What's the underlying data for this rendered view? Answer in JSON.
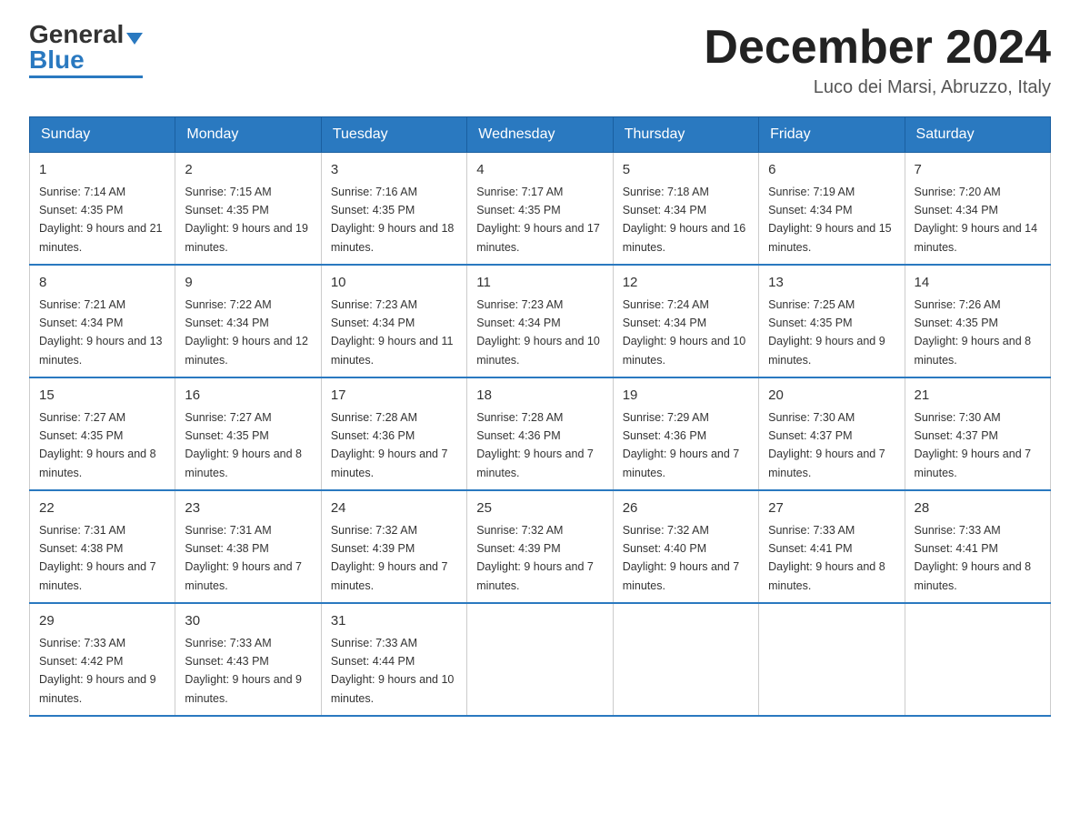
{
  "header": {
    "logo_general": "General",
    "logo_blue": "Blue",
    "month_title": "December 2024",
    "location": "Luco dei Marsi, Abruzzo, Italy"
  },
  "weekdays": [
    "Sunday",
    "Monday",
    "Tuesday",
    "Wednesday",
    "Thursday",
    "Friday",
    "Saturday"
  ],
  "weeks": [
    [
      {
        "day": "1",
        "sunrise": "7:14 AM",
        "sunset": "4:35 PM",
        "daylight": "9 hours and 21 minutes."
      },
      {
        "day": "2",
        "sunrise": "7:15 AM",
        "sunset": "4:35 PM",
        "daylight": "9 hours and 19 minutes."
      },
      {
        "day": "3",
        "sunrise": "7:16 AM",
        "sunset": "4:35 PM",
        "daylight": "9 hours and 18 minutes."
      },
      {
        "day": "4",
        "sunrise": "7:17 AM",
        "sunset": "4:35 PM",
        "daylight": "9 hours and 17 minutes."
      },
      {
        "day": "5",
        "sunrise": "7:18 AM",
        "sunset": "4:34 PM",
        "daylight": "9 hours and 16 minutes."
      },
      {
        "day": "6",
        "sunrise": "7:19 AM",
        "sunset": "4:34 PM",
        "daylight": "9 hours and 15 minutes."
      },
      {
        "day": "7",
        "sunrise": "7:20 AM",
        "sunset": "4:34 PM",
        "daylight": "9 hours and 14 minutes."
      }
    ],
    [
      {
        "day": "8",
        "sunrise": "7:21 AM",
        "sunset": "4:34 PM",
        "daylight": "9 hours and 13 minutes."
      },
      {
        "day": "9",
        "sunrise": "7:22 AM",
        "sunset": "4:34 PM",
        "daylight": "9 hours and 12 minutes."
      },
      {
        "day": "10",
        "sunrise": "7:23 AM",
        "sunset": "4:34 PM",
        "daylight": "9 hours and 11 minutes."
      },
      {
        "day": "11",
        "sunrise": "7:23 AM",
        "sunset": "4:34 PM",
        "daylight": "9 hours and 10 minutes."
      },
      {
        "day": "12",
        "sunrise": "7:24 AM",
        "sunset": "4:34 PM",
        "daylight": "9 hours and 10 minutes."
      },
      {
        "day": "13",
        "sunrise": "7:25 AM",
        "sunset": "4:35 PM",
        "daylight": "9 hours and 9 minutes."
      },
      {
        "day": "14",
        "sunrise": "7:26 AM",
        "sunset": "4:35 PM",
        "daylight": "9 hours and 8 minutes."
      }
    ],
    [
      {
        "day": "15",
        "sunrise": "7:27 AM",
        "sunset": "4:35 PM",
        "daylight": "9 hours and 8 minutes."
      },
      {
        "day": "16",
        "sunrise": "7:27 AM",
        "sunset": "4:35 PM",
        "daylight": "9 hours and 8 minutes."
      },
      {
        "day": "17",
        "sunrise": "7:28 AM",
        "sunset": "4:36 PM",
        "daylight": "9 hours and 7 minutes."
      },
      {
        "day": "18",
        "sunrise": "7:28 AM",
        "sunset": "4:36 PM",
        "daylight": "9 hours and 7 minutes."
      },
      {
        "day": "19",
        "sunrise": "7:29 AM",
        "sunset": "4:36 PM",
        "daylight": "9 hours and 7 minutes."
      },
      {
        "day": "20",
        "sunrise": "7:30 AM",
        "sunset": "4:37 PM",
        "daylight": "9 hours and 7 minutes."
      },
      {
        "day": "21",
        "sunrise": "7:30 AM",
        "sunset": "4:37 PM",
        "daylight": "9 hours and 7 minutes."
      }
    ],
    [
      {
        "day": "22",
        "sunrise": "7:31 AM",
        "sunset": "4:38 PM",
        "daylight": "9 hours and 7 minutes."
      },
      {
        "day": "23",
        "sunrise": "7:31 AM",
        "sunset": "4:38 PM",
        "daylight": "9 hours and 7 minutes."
      },
      {
        "day": "24",
        "sunrise": "7:32 AM",
        "sunset": "4:39 PM",
        "daylight": "9 hours and 7 minutes."
      },
      {
        "day": "25",
        "sunrise": "7:32 AM",
        "sunset": "4:39 PM",
        "daylight": "9 hours and 7 minutes."
      },
      {
        "day": "26",
        "sunrise": "7:32 AM",
        "sunset": "4:40 PM",
        "daylight": "9 hours and 7 minutes."
      },
      {
        "day": "27",
        "sunrise": "7:33 AM",
        "sunset": "4:41 PM",
        "daylight": "9 hours and 8 minutes."
      },
      {
        "day": "28",
        "sunrise": "7:33 AM",
        "sunset": "4:41 PM",
        "daylight": "9 hours and 8 minutes."
      }
    ],
    [
      {
        "day": "29",
        "sunrise": "7:33 AM",
        "sunset": "4:42 PM",
        "daylight": "9 hours and 9 minutes."
      },
      {
        "day": "30",
        "sunrise": "7:33 AM",
        "sunset": "4:43 PM",
        "daylight": "9 hours and 9 minutes."
      },
      {
        "day": "31",
        "sunrise": "7:33 AM",
        "sunset": "4:44 PM",
        "daylight": "9 hours and 10 minutes."
      },
      null,
      null,
      null,
      null
    ]
  ]
}
